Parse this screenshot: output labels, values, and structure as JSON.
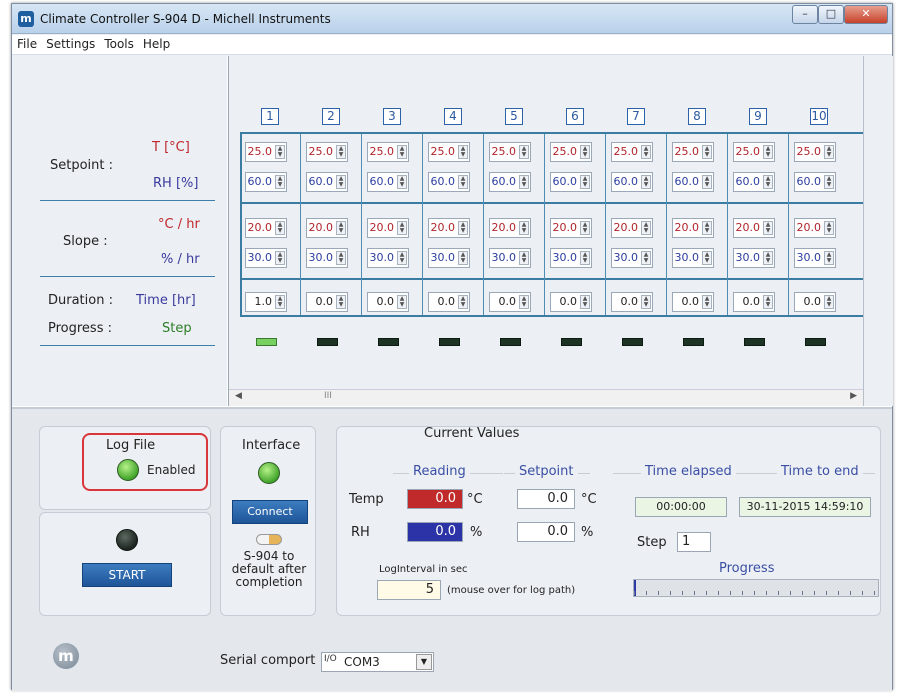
{
  "window": {
    "title": "Climate Controller S-904 D  -  Michell Instruments",
    "icon": "michell-logo-icon"
  },
  "menu": [
    "File",
    "Settings",
    "Tools",
    "Help"
  ],
  "left_labels": {
    "setpoint": "Setpoint :",
    "t_unit": "T [°C]",
    "rh_unit": "RH [%]",
    "slope": "Slope :",
    "slope_t": "°C / hr",
    "slope_rh": "% / hr",
    "duration": "Duration :",
    "time_hr": "Time [hr]",
    "progress": "Progress :",
    "step": "Step"
  },
  "columns": [
    "1",
    "2",
    "3",
    "4",
    "5",
    "6",
    "7",
    "8",
    "9",
    "10"
  ],
  "rows": {
    "setpoint_t": [
      "25.0",
      "25.0",
      "25.0",
      "25.0",
      "25.0",
      "25.0",
      "25.0",
      "25.0",
      "25.0",
      "25.0"
    ],
    "setpoint_rh": [
      "60.0",
      "60.0",
      "60.0",
      "60.0",
      "60.0",
      "60.0",
      "60.0",
      "60.0",
      "60.0",
      "60.0"
    ],
    "slope_t": [
      "20.0",
      "20.0",
      "20.0",
      "20.0",
      "20.0",
      "20.0",
      "20.0",
      "20.0",
      "20.0",
      "20.0"
    ],
    "slope_rh": [
      "30.0",
      "30.0",
      "30.0",
      "30.0",
      "30.0",
      "30.0",
      "30.0",
      "30.0",
      "30.0",
      "30.0"
    ],
    "duration": [
      "1.0",
      "0.0",
      "0.0",
      "0.0",
      "0.0",
      "0.0",
      "0.0",
      "0.0",
      "0.0",
      "0.0"
    ]
  },
  "step_leds": [
    true,
    false,
    false,
    false,
    false,
    false,
    false,
    false,
    false,
    false
  ],
  "scrollbar_glyph": "III",
  "log": {
    "title": "Log File",
    "state": "Enabled",
    "start": "START"
  },
  "interface": {
    "title": "Interface",
    "connect": "Connect",
    "default_text": "S-904 to default after completion"
  },
  "current": {
    "title": "Current Values",
    "reading": "Reading",
    "setpoint": "Setpoint",
    "temp_label": "Temp",
    "rh_label": "RH",
    "temp_reading": "0.0",
    "temp_unit": "°C",
    "rh_reading": "0.0",
    "rh_unit": "%",
    "temp_setpoint": "0.0",
    "rh_setpoint": "0.0",
    "time_elapsed_label": "Time elapsed",
    "time_to_end_label": "Time to end",
    "time_elapsed": "00:00:00",
    "time_to_end": "30-11-2015 14:59:10",
    "step_label": "Step",
    "step_value": "1",
    "loginterval_label": "LogInterval in sec",
    "loginterval_value": "5",
    "loginterval_hint": "(mouse over for log path)",
    "progress_label": "Progress",
    "progress_fraction": 0.0
  },
  "serial": {
    "label": "Serial comport",
    "glyph": "I/O",
    "value": "COM3"
  },
  "colors": {
    "accent": "#2c5aa0",
    "red_field": "#c02a2a",
    "blue_field": "#2b33a6",
    "led_on": "#5ec03f",
    "frame": "#3a7ca2"
  }
}
